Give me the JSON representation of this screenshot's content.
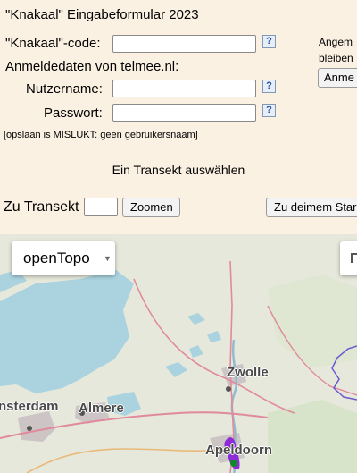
{
  "title": "\"Knakaal\" Eingabeformular 2023",
  "form": {
    "code_label": "\"Knakaal\"-code:",
    "code_value": "",
    "login_heading": "Anmeldedaten von telmee.nl:",
    "username_label": "Nutzername:",
    "username_value": "",
    "password_label": "Passwort:",
    "password_value": "",
    "help_glyph": "?",
    "status": "[opslaan is MISLUKT: geen gebruikersnaam]"
  },
  "side": {
    "line1": "Angem",
    "line2": "bleiben",
    "button": "Anme"
  },
  "transect": {
    "heading": "Ein Transekt auswählen",
    "label": "Zu Transekt",
    "value": "",
    "zoom_button": "Zoomen",
    "start_button": "Zu deimem Star"
  },
  "map": {
    "layer": "openTopo",
    "cities": {
      "amsterdam": "nsterdam",
      "almere": "Almere",
      "zwolle": "Zwolle",
      "apeldoorn": "Apeldoorn"
    },
    "colors": {
      "water": "#aad3df",
      "land": "#e6e8db",
      "forest": "#cfe0c0",
      "urban": "#c9c1c1",
      "road": "#e08a9b",
      "border": "#6a5acd",
      "marker_green": "#0f8a2a",
      "marker_purple": "#8d2bd6"
    }
  }
}
